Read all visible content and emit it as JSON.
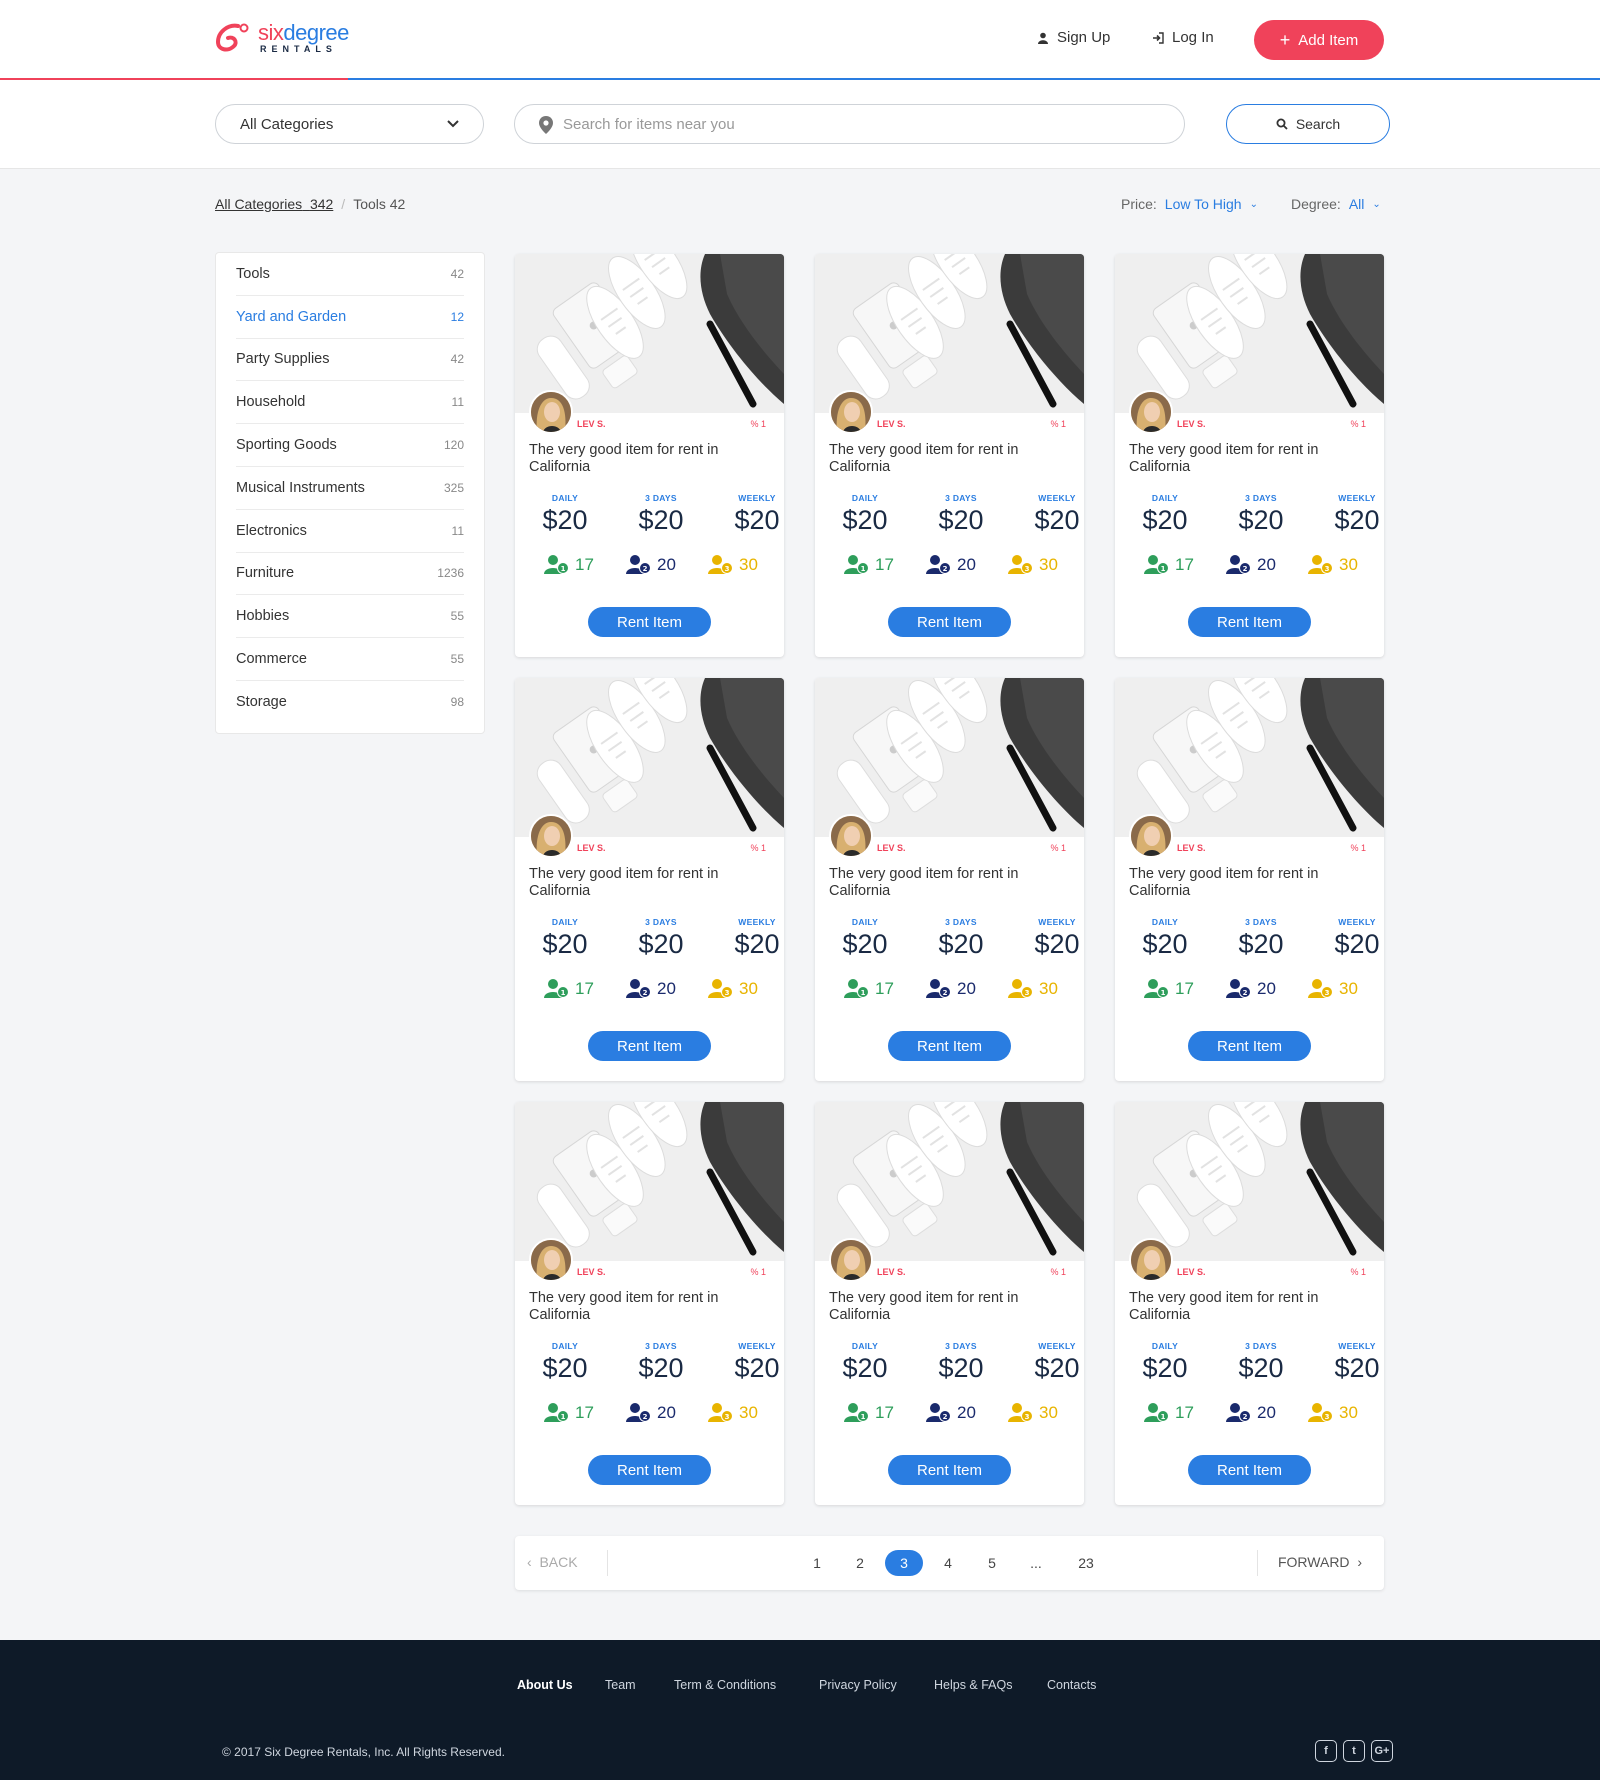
{
  "brand": {
    "word_six": "six",
    "word_degree": "degree",
    "sub": "RENTALS",
    "accent": "#2a7de1",
    "red": "#f0425a"
  },
  "nav": {
    "signup": "Sign Up",
    "login": "Log In",
    "add_item": "Add Item"
  },
  "search": {
    "category": "All Categories",
    "placeholder": "Search for items near you",
    "button": "Search"
  },
  "breadcrumb": {
    "all": "All Categories",
    "all_count": "342",
    "current": "Tools 42"
  },
  "sort": {
    "price_label": "Price:",
    "price_value": "Low To High",
    "degree_label": "Degree:",
    "degree_value": "All"
  },
  "categories": [
    {
      "name": "Tools",
      "count": "42"
    },
    {
      "name": "Yard and Garden",
      "count": "12"
    },
    {
      "name": "Party Supplies",
      "count": "42"
    },
    {
      "name": "Household",
      "count": "11"
    },
    {
      "name": "Sporting Goods",
      "count": "120"
    },
    {
      "name": "Musical Instruments",
      "count": "325"
    },
    {
      "name": "Electronics",
      "count": "11"
    },
    {
      "name": "Furniture",
      "count": "1236"
    },
    {
      "name": "Hobbies",
      "count": "55"
    },
    {
      "name": "Commerce",
      "count": "55"
    },
    {
      "name": "Storage",
      "count": "98"
    }
  ],
  "active_category": 1,
  "card": {
    "owner": "LEV S.",
    "degree_badge": "1",
    "title": "The very good item for rent in California",
    "prices": [
      {
        "label": "DAILY",
        "value": "$20"
      },
      {
        "label": "3 DAYS",
        "value": "$20"
      },
      {
        "label": "WEEKLY",
        "value": "$20"
      }
    ],
    "degrees": [
      {
        "level": "1",
        "count": "17",
        "color": "#2e9e5b"
      },
      {
        "level": "2",
        "count": "20",
        "color": "#1a2a6c"
      },
      {
        "level": "3",
        "count": "30",
        "color": "#e8b400"
      }
    ],
    "button": "Rent Item"
  },
  "pagination": {
    "back": "BACK",
    "forward": "FORWARD",
    "pages": [
      "1",
      "2",
      "3",
      "4",
      "5",
      "...",
      "23"
    ],
    "current": "3"
  },
  "footer": {
    "links": [
      "About Us",
      "Team",
      "Term & Conditions",
      "Privacy Policy",
      "Helps & FAQs",
      "Contacts"
    ],
    "copyright": "© 2017  Six Degree Rentals, Inc. All Rights Reserved.",
    "social": [
      "f",
      "t",
      "G+"
    ]
  }
}
